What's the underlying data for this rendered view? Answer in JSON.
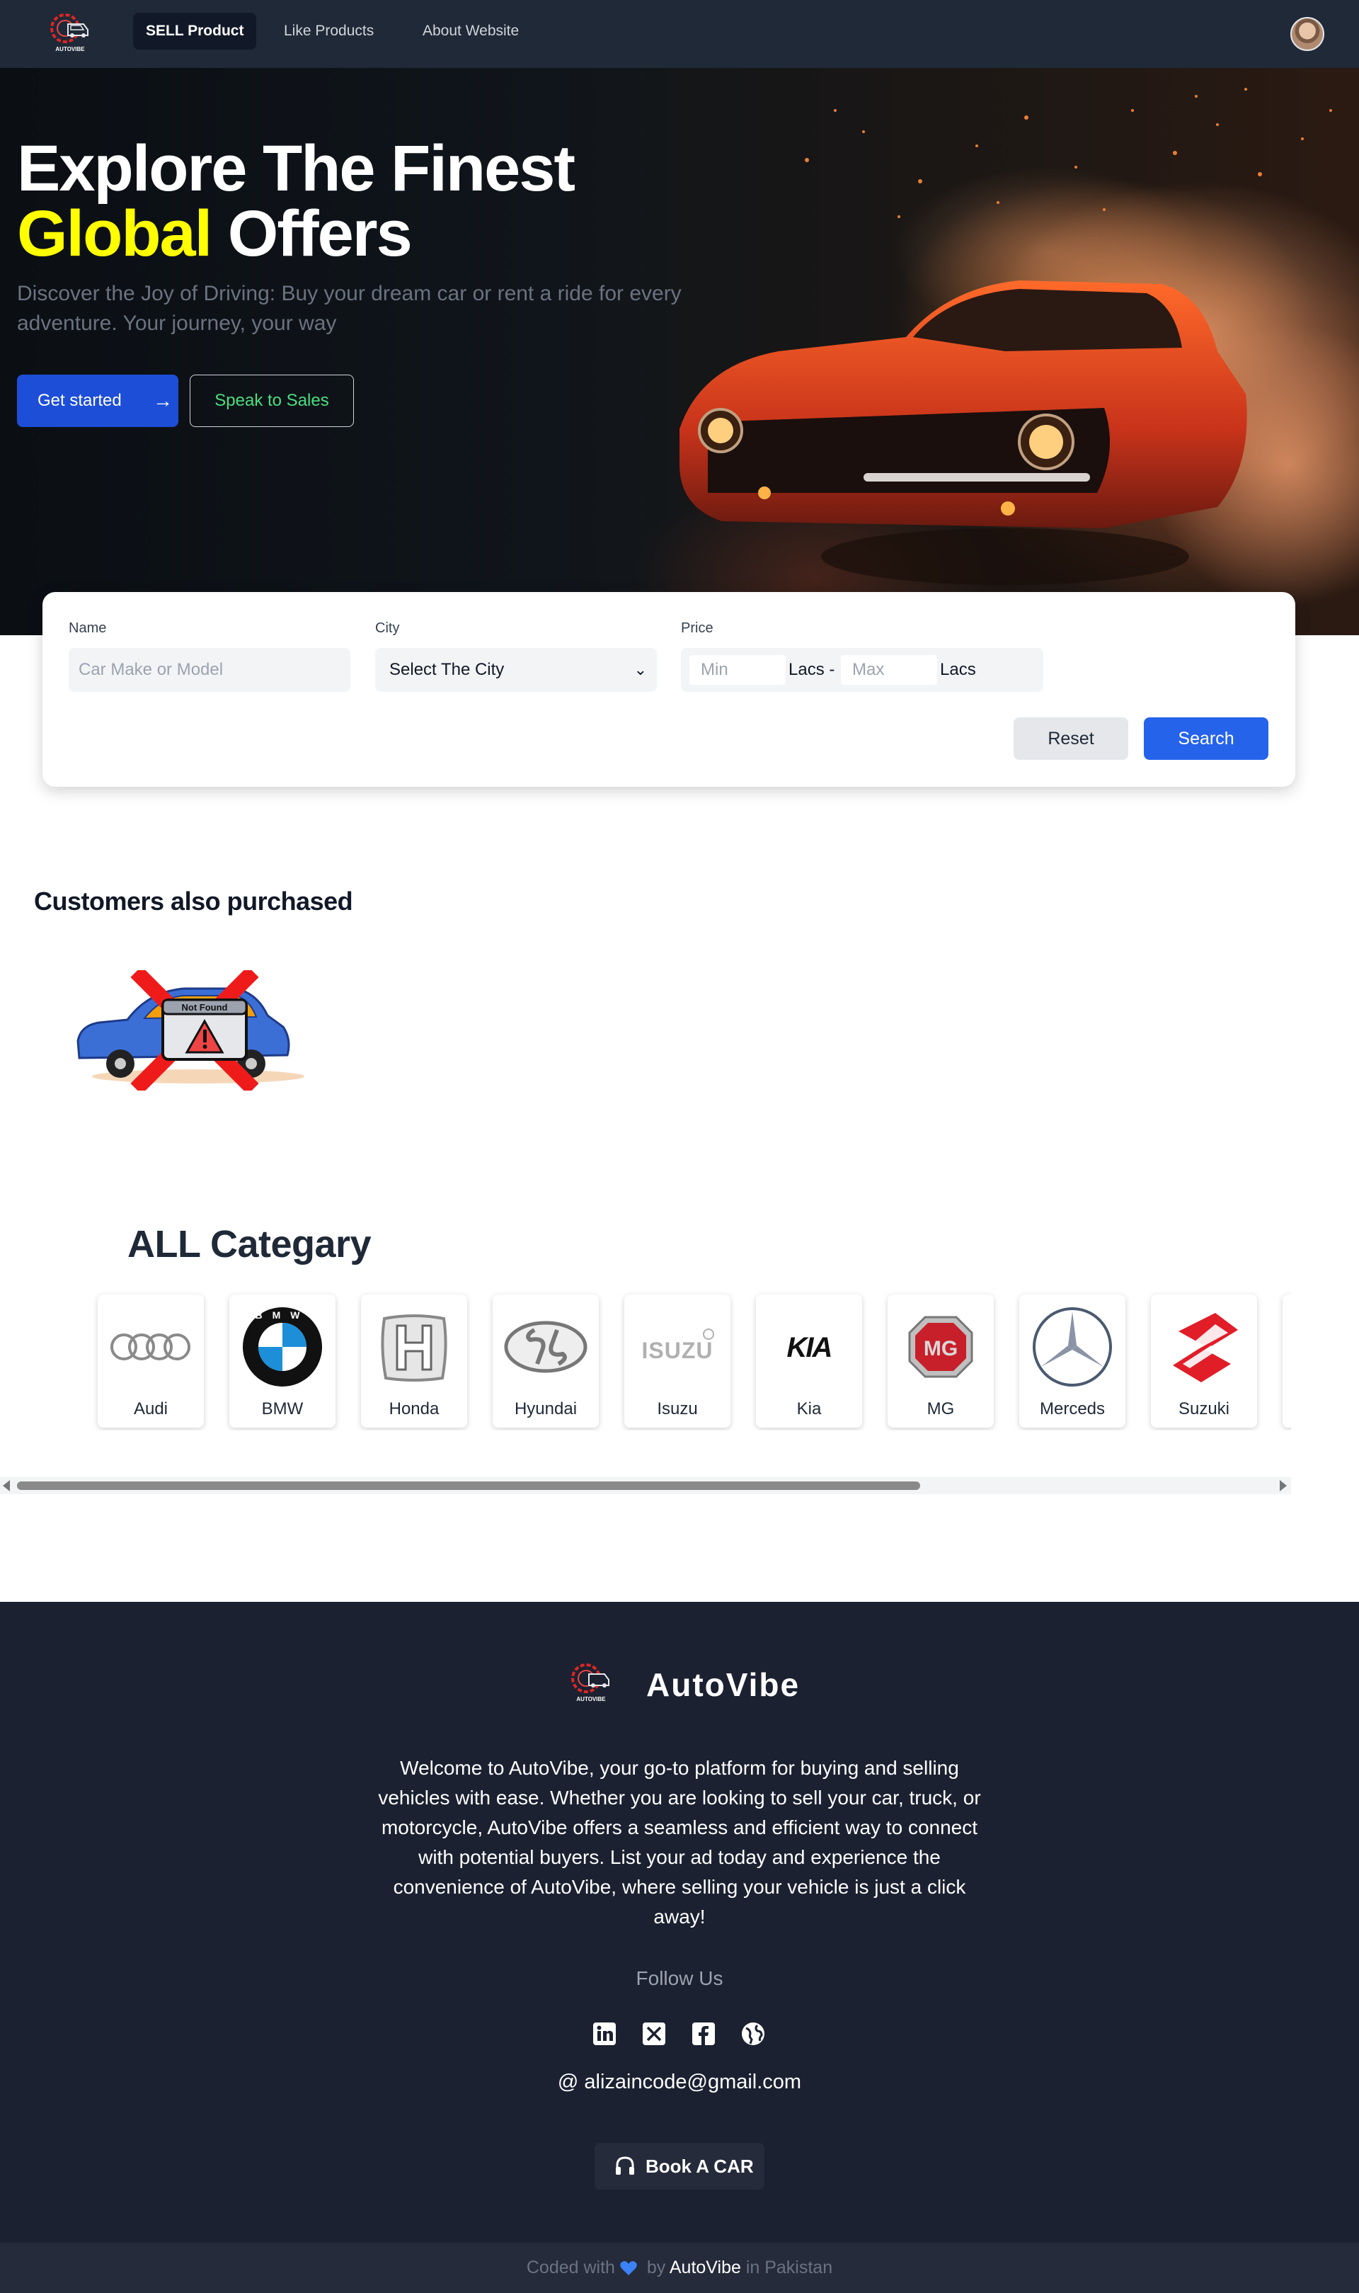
{
  "nav": {
    "logo_text": "AUTOVIBE",
    "links": [
      {
        "label": "SELL Product",
        "active": true
      },
      {
        "label": "Like Products",
        "active": false
      },
      {
        "label": "About Website",
        "active": false
      }
    ]
  },
  "hero": {
    "title_line1": "Explore The Finest",
    "title_highlight": "Global",
    "title_line2_rest": " Offers",
    "subtitle": "Discover the Joy of Driving: Buy your dream car or rent a ride for every adventure. Your journey, your way",
    "primary_button": "Get started",
    "primary_button_icon": "→",
    "secondary_button": "Speak to Sales"
  },
  "search": {
    "name_label": "Name",
    "name_placeholder": "Car Make or Model",
    "city_label": "City",
    "city_value": "Select The City",
    "price_label": "Price",
    "min_placeholder": "Min",
    "max_placeholder": "Max",
    "unit_min": "Lacs -",
    "unit_max": "Lacs",
    "reset": "Reset",
    "search": "Search"
  },
  "customers": {
    "title": "Customers also purchased",
    "not_found_text": "Not Found"
  },
  "category": {
    "title": "ALL Categary",
    "items": [
      "Audi",
      "BMW",
      "Honda",
      "Hyundai",
      "Isuzu",
      "Kia",
      "MG",
      "Merceds",
      "Suzuki"
    ],
    "bmw_letters": "BMW",
    "isuzu_text": "ISUZU",
    "kia_text": "KIA",
    "mg_text": "MG"
  },
  "footer": {
    "brand": "AutoVibe",
    "logo_text": "AUTOVIBE",
    "description": "Welcome to AutoVibe, your go-to platform for buying and selling vehicles with ease. Whether you are looking to sell your car, truck, or motorcycle, AutoVibe offers a seamless and efficient way to connect with potential buyers. List your ad today and experience the convenience of AutoVibe, where selling your vehicle is just a click away!",
    "follow_label": "Follow Us",
    "email": "@  alizaincode@gmail.com",
    "book_button": "Book A CAR",
    "socials": [
      "linkedin-icon",
      "x-icon",
      "facebook-icon",
      "globe-icon"
    ]
  },
  "bottom": {
    "prefix": "Coded with",
    "by": " by ",
    "brand": "AutoVibe",
    "suffix": " in Pakistan"
  },
  "colors": {
    "nav_bg": "#1f2937",
    "accent_yellow": "#ffff00",
    "primary_blue": "#2563eb",
    "sales_green": "#4ade80",
    "footer_bg": "#1b2130"
  }
}
